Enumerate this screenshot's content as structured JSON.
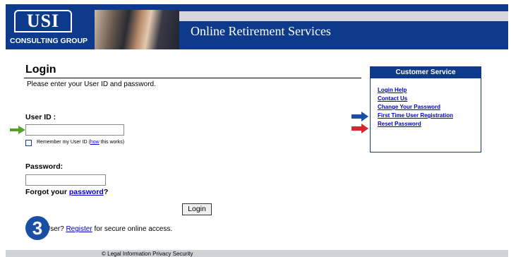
{
  "header": {
    "logo_text": "USI",
    "logo_subtitle": "CONSULTING GROUP",
    "title": "Online Retirement Services"
  },
  "login": {
    "heading": "Login",
    "instructions": "Please enter your User ID and password.",
    "user_id_label": "User ID :",
    "user_id_value": "",
    "remember_prefix": "Remember my User ID (",
    "remember_link": "how",
    "remember_suffix": " this works)",
    "password_label": "Password:",
    "password_value": "",
    "forgot_prefix": "Forgot your ",
    "forgot_link": "password",
    "forgot_suffix": "?",
    "login_button": "Login",
    "newuser_prefix": "New User? ",
    "newuser_visible_prefix": "User? ",
    "register_link": "Register",
    "newuser_suffix": " for secure online access."
  },
  "customer_service": {
    "heading": "Customer Service",
    "links": [
      "Login Help",
      "Contact Us",
      "Change Your Password",
      "First Time User Registration",
      "Reset Password"
    ]
  },
  "footer": {
    "text": "© Legal Information   Privacy   Security"
  },
  "annotations": {
    "step_number": "3",
    "arrow_colors": {
      "green": "#5aa02c",
      "blue": "#1a4fa3",
      "red": "#d8262e"
    }
  }
}
